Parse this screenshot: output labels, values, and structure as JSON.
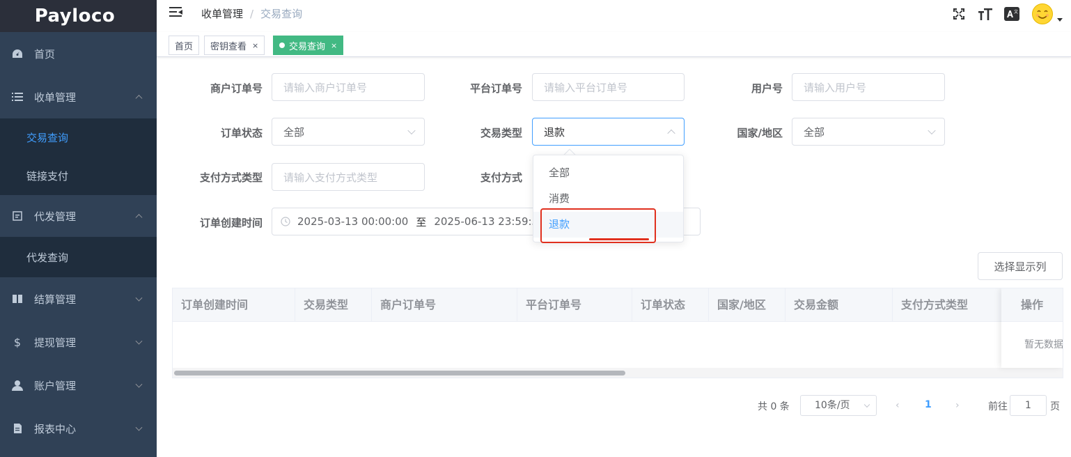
{
  "app": {
    "logo": "Payloco"
  },
  "sidebar": {
    "items": [
      {
        "label": "首页",
        "icon": "dashboard-icon"
      },
      {
        "label": "收单管理",
        "icon": "list-icon",
        "children": [
          {
            "label": "交易查询",
            "active": true
          },
          {
            "label": "链接支付"
          }
        ]
      },
      {
        "label": "代发管理",
        "icon": "document-icon",
        "children": [
          {
            "label": "代发查询"
          }
        ]
      },
      {
        "label": "结算管理",
        "icon": "book-icon"
      },
      {
        "label": "提现管理",
        "icon": "dollar-icon"
      },
      {
        "label": "账户管理",
        "icon": "user-icon"
      },
      {
        "label": "报表中心",
        "icon": "report-icon"
      }
    ]
  },
  "header": {
    "breadcrumb": [
      "收单管理",
      "/",
      "交易查询"
    ],
    "icons": [
      "fullscreen-icon",
      "font-size-icon",
      "language-icon",
      "avatar"
    ]
  },
  "tags": [
    {
      "label": "首页",
      "active": false,
      "close": ""
    },
    {
      "label": "密钥查看",
      "active": false,
      "close": "×"
    },
    {
      "label": "交易查询",
      "active": true,
      "close": "×"
    }
  ],
  "form": {
    "merchant_order_label": "商户订单号",
    "merchant_order_placeholder": "请输入商户订单号",
    "platform_order_label": "平台订单号",
    "platform_order_placeholder": "请输入平台订单号",
    "user_no_label": "用户号",
    "user_no_placeholder": "请输入用户号",
    "order_status_label": "订单状态",
    "order_status_value": "全部",
    "trade_type_label": "交易类型",
    "trade_type_value": "退款",
    "country_label": "国家/地区",
    "country_value": "全部",
    "pay_method_type_label": "支付方式类型",
    "pay_method_type_placeholder": "请输入支付方式类型",
    "pay_method_label": "支付方式",
    "create_time_label": "订单创建时间",
    "start_time": "2025-03-13 00:00:00",
    "range_sep": "至",
    "end_time": "2025-06-13 23:59:59"
  },
  "trade_type_options": [
    "全部",
    "消费",
    "退款"
  ],
  "trade_type_selected": "退款",
  "columns_button": "选择显示列",
  "table": {
    "headers": [
      "订单创建时间",
      "交易类型",
      "商户订单号",
      "平台订单号",
      "订单状态",
      "国家/地区",
      "交易金额",
      "支付方式类型"
    ],
    "fixed_header": "操作",
    "empty_text": "暂无数据"
  },
  "pagination": {
    "total": "共 0 条",
    "page_size": "10条/页",
    "current_page": "1",
    "goto_prefix": "前往",
    "goto_value": "1",
    "goto_suffix": "页",
    "prev": "‹",
    "next": "›"
  },
  "colors": {
    "sidebar_bg": "#304156",
    "accent": "#409eff",
    "tag_active": "#42b983",
    "highlight": "#e0301e"
  }
}
